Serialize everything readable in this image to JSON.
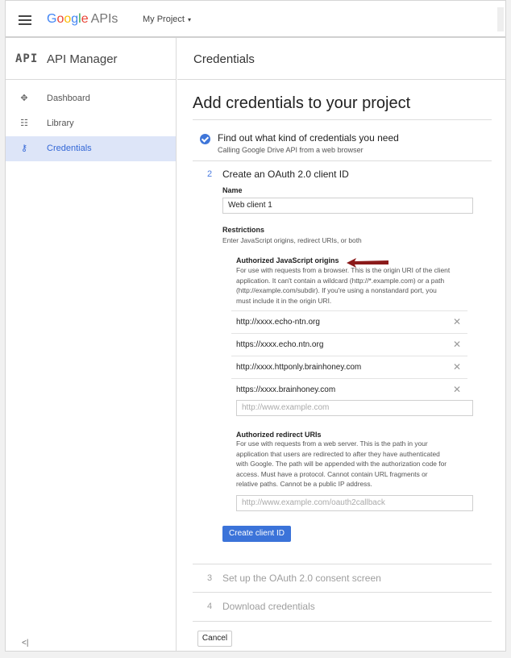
{
  "topbar": {
    "logo_g": [
      "G",
      "o",
      "o",
      "g",
      "l",
      "e"
    ],
    "logo_apis": "APIs",
    "project": "My Project",
    "project_caret": "▾"
  },
  "sidebar": {
    "logo_text": "API",
    "title": "API Manager",
    "items": [
      {
        "label": "Dashboard",
        "icon": "move-icon",
        "glyph": "✥"
      },
      {
        "label": "Library",
        "icon": "library-icon",
        "glyph": "☷"
      },
      {
        "label": "Credentials",
        "icon": "key-icon",
        "glyph": "⚷"
      }
    ],
    "collapse": "<|"
  },
  "main": {
    "header": "Credentials",
    "page_title": "Add credentials to your project",
    "step1": {
      "title": "Find out what kind of credentials you need",
      "subtitle": "Calling Google Drive API from a web browser"
    },
    "step2": {
      "num": "2",
      "title": "Create an OAuth 2.0 client ID",
      "name_label": "Name",
      "name_value": "Web client 1",
      "restrictions_label": "Restrictions",
      "restrictions_help": "Enter JavaScript origins, redirect URIs, or both",
      "js_origins_label": "Authorized JavaScript origins",
      "js_origins_help": [
        "For use with requests from a browser. This is the origin URI of the client",
        "application. It can't contain a wildcard (http://*.example.com) or a path",
        "(http://example.com/subdir). If you're using a nonstandard port, you",
        "must include it in the origin URI."
      ],
      "origins": [
        "http://xxxx.echo-ntn.org",
        "https://xxxx.echo.ntn.org",
        "http://xxxx.httponly.brainhoney.com",
        "https://xxxx.brainhoney.com"
      ],
      "remove_glyph": "✕",
      "origin_placeholder": "http://www.example.com",
      "redirect_label": "Authorized redirect URIs",
      "redirect_help": [
        "For use with requests from a web server. This is the path in your",
        "application that users are redirected to after they have authenticated",
        "with Google. The path will be appended with the authorization code for",
        "access. Must have a protocol. Cannot contain URL fragments or",
        "relative paths. Cannot be a public IP address."
      ],
      "redirect_placeholder": "http://www.example.com/oauth2callback",
      "create_button": "Create client ID"
    },
    "step3": {
      "num": "3",
      "title": "Set up the OAuth 2.0 consent screen"
    },
    "step4": {
      "num": "4",
      "title": "Download credentials"
    },
    "cancel_button": "Cancel"
  },
  "colors": {
    "accent": "#3b73d9",
    "active_nav_bg": "#dde5f8",
    "annotation_arrow": "#8b1a1a"
  }
}
